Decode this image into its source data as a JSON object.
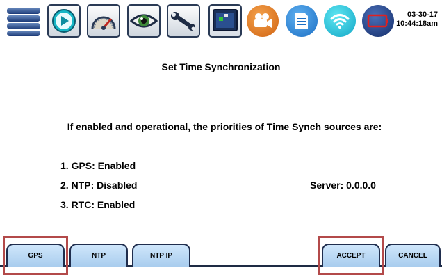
{
  "toolbar": {
    "icons": [
      "menu-icon",
      "play-icon",
      "gauge-icon",
      "eye-icon",
      "wrench-icon",
      "monitor-icon",
      "camera-icon",
      "document-icon",
      "wifi-icon",
      "battery-icon"
    ],
    "date": "03-30-17",
    "time": "10:44:18am"
  },
  "main": {
    "title": "Set Time Synchronization",
    "priority_text": "If enabled and operational, the priorities of Time Synch sources are:",
    "sources": [
      {
        "label": "1. GPS: Enabled"
      },
      {
        "label": "2. NTP: Disabled"
      },
      {
        "label": "3. RTC: Enabled"
      }
    ],
    "server_text": "Server: 0.0.0.0"
  },
  "softkeys": {
    "gps": "GPS",
    "ntp": "NTP",
    "ntp_ip": "NTP IP",
    "accept": "ACCEPT",
    "cancel": "CANCEL"
  },
  "colors": {
    "highlight": "#b34a4a",
    "button_top": "#cfe6fb",
    "button_bottom": "#a9cdee",
    "border": "#1f2d4d"
  }
}
